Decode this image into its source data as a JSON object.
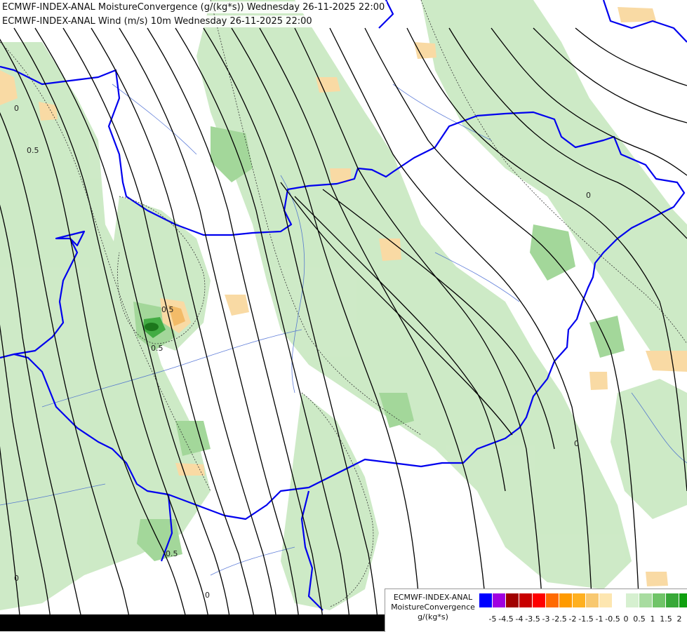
{
  "titles": {
    "line1": "ECMWF-INDEX-ANAL MoistureConvergence (g/(kg*s)) Wednesday 26-11-2025 22:00",
    "line2": "ECMWF-INDEX-ANAL Wind (m/s) 10m Wednesday 26-11-2025 22:00"
  },
  "legend": {
    "line1": "ECMWF-INDEX-ANAL",
    "line2": "MoistureConvergence",
    "unit": "g/(kg*s)",
    "swatch_colors": [
      "#0000ff",
      "#a000e0",
      "#a00000",
      "#c80000",
      "#ff0000",
      "#ff6a00",
      "#ff9a00",
      "#ffb020",
      "#f8c870",
      "#fde6b0",
      "#ffffff",
      "#d6f0d0",
      "#a8dca0",
      "#70c468",
      "#38a838",
      "#10a010"
    ],
    "tick_labels": [
      "-5",
      "-4.5",
      "-4",
      "-3.5",
      "-3",
      "-2.5",
      "-2",
      "-1.5",
      "-1",
      "-0.5",
      "0",
      "0.5",
      "1",
      "1.5",
      "2"
    ]
  },
  "map_labels": [
    {
      "text": "0"
    },
    {
      "text": "0.5"
    },
    {
      "text": "0.5"
    },
    {
      "text": "0.5"
    },
    {
      "text": "0"
    },
    {
      "text": "0"
    },
    {
      "text": "0"
    },
    {
      "text": "0"
    },
    {
      "text": "0.5"
    }
  ],
  "colors": {
    "border": "#0000ee",
    "river": "#3a5fd0",
    "streamline": "#000000",
    "green_light": "#cbe9c4",
    "green_mid": "#9fd595",
    "green_dark": "#39a83a",
    "orange_light": "#f9d9a0",
    "orange_mid": "#f3b860"
  }
}
